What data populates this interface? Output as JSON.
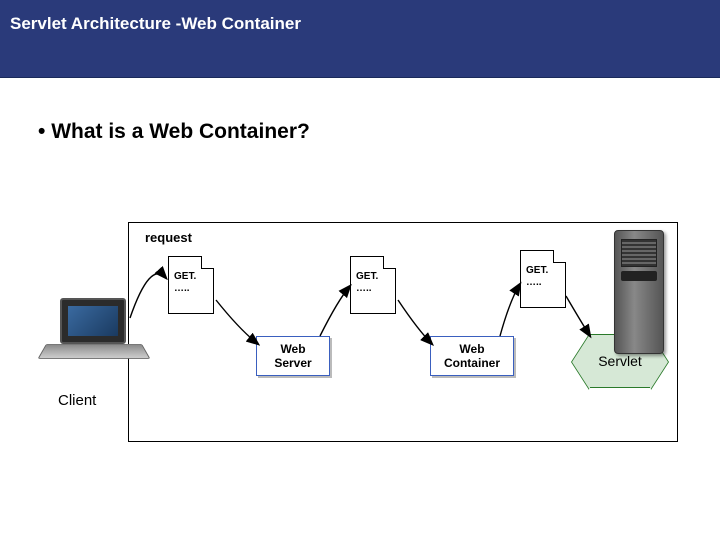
{
  "header": {
    "title": "Servlet Architecture  -Web Container"
  },
  "heading": "What is a Web Container?",
  "labels": {
    "request": "request",
    "client": "Client"
  },
  "pages": {
    "p1": {
      "line1": "GET.",
      "line2": "….."
    },
    "p2": {
      "line1": "GET.",
      "line2": "….."
    },
    "p3": {
      "line1": "GET.",
      "line2": "….."
    }
  },
  "boxes": {
    "webserver": "Web\nServer",
    "webcontainer": "Web\nContainer"
  },
  "hex": {
    "servlet": "Servlet"
  }
}
